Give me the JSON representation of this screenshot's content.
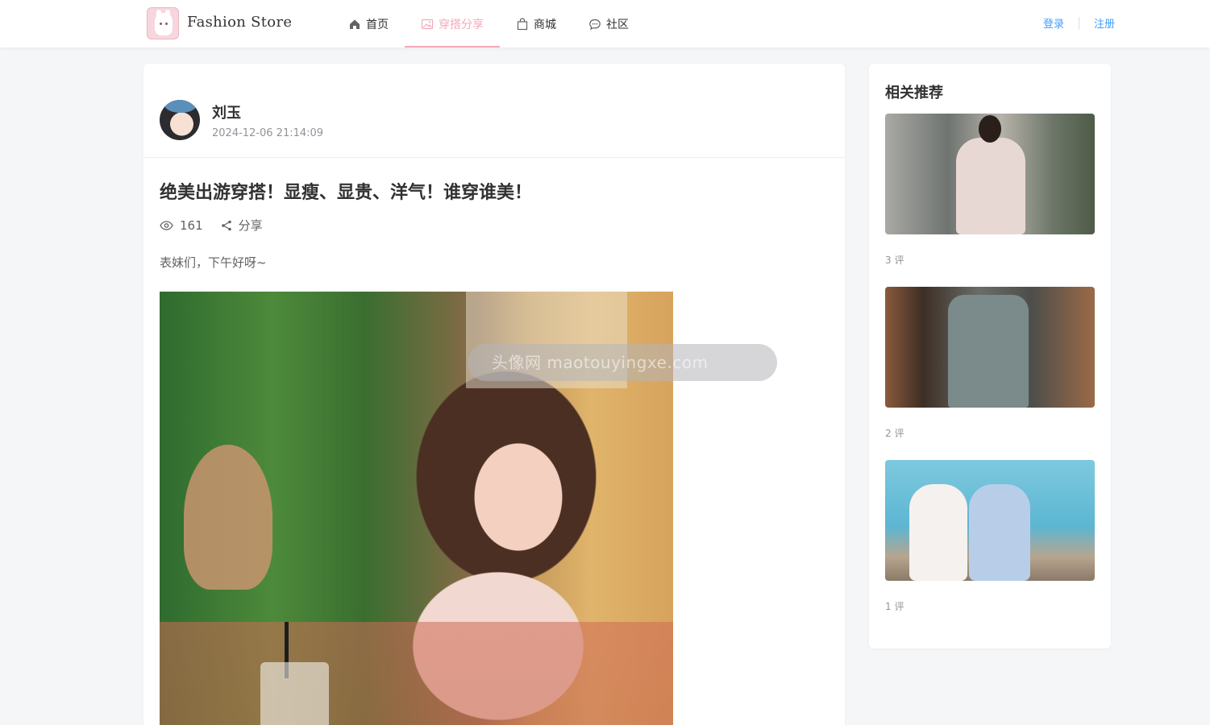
{
  "header": {
    "brand": "Fashion Store",
    "nav": [
      {
        "label": "首页",
        "icon": "home-icon",
        "active": false
      },
      {
        "label": "穿搭分享",
        "icon": "image-icon",
        "active": true
      },
      {
        "label": "商城",
        "icon": "shopping-bag-icon",
        "active": false
      },
      {
        "label": "社区",
        "icon": "chat-bubble-icon",
        "active": false
      }
    ],
    "login": "登录",
    "register": "注册"
  },
  "post": {
    "author_name": "刘玉",
    "time": "2024-12-06 21:14:09",
    "title": "绝美出游穿搭！显瘦、显贵、洋气！谁穿谁美！",
    "views": "161",
    "share": "分享",
    "text": "表妹们，下午好呀~",
    "watermark": "头像网 maotouyingxe.com"
  },
  "sidebar": {
    "title": "相关推荐",
    "items": [
      {
        "count": "3 评"
      },
      {
        "count": "2 评"
      },
      {
        "count": "1 评"
      }
    ]
  },
  "colors": {
    "accent": "#f4a9b8",
    "link": "#409eff",
    "text": "#303133",
    "muted": "#909399"
  }
}
